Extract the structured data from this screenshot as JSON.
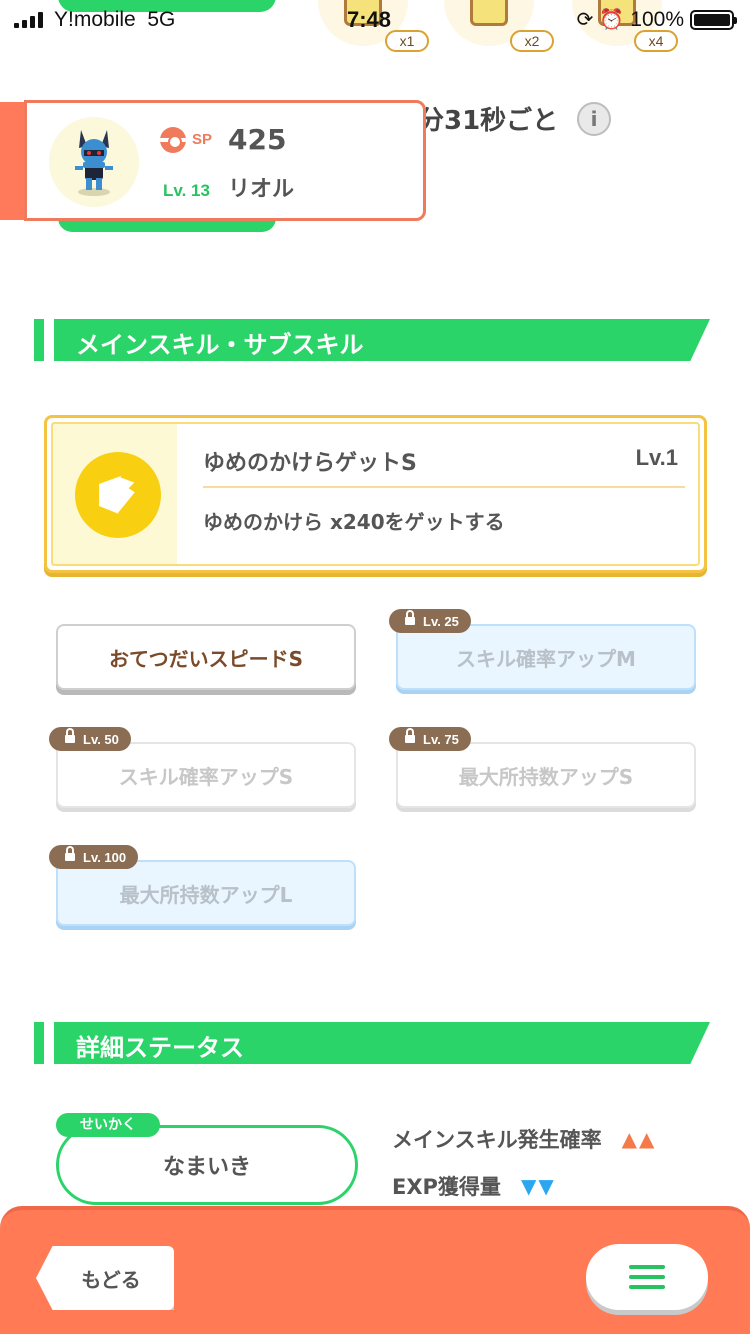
{
  "status_bar": {
    "carrier": "Y!mobile",
    "network": "5G",
    "time": "7:48",
    "battery": "100%"
  },
  "top_partial": {
    "multipliers": [
      "x1",
      "x2",
      "x4"
    ],
    "interval_text": "分31秒ごと",
    "info_label": "i"
  },
  "pokemon": {
    "sp_label": "SP",
    "sp_value": "425",
    "level": "Lv. 13",
    "name": "リオル"
  },
  "section_skills": {
    "title": "メインスキル・サブスキル"
  },
  "main_skill": {
    "name": "ゆめのかけらゲットS",
    "level": "Lv.1",
    "description": "ゆめのかけら x240をゲットする"
  },
  "sub_skills": [
    {
      "name": "おてつだいスピードS",
      "unlock": ""
    },
    {
      "name": "スキル確率アップM",
      "unlock": "Lv. 25"
    },
    {
      "name": "スキル確率アップS",
      "unlock": "Lv. 50"
    },
    {
      "name": "最大所持数アップS",
      "unlock": "Lv. 75"
    },
    {
      "name": "最大所持数アップL",
      "unlock": "Lv. 100"
    }
  ],
  "section_details": {
    "title": "詳細ステータス"
  },
  "nature": {
    "tag": "せいかく",
    "value": "なまいき",
    "up_stat": "メインスキル発生確率",
    "up_marks": "▲▲",
    "down_stat": "EXP獲得量",
    "down_marks": "▼▼"
  },
  "nav": {
    "back_label": "もどる"
  },
  "colors": {
    "accent_green": "#2ad468",
    "accent_orange": "#ff7a55",
    "skill_yellow": "#f9cf12",
    "up_color": "#f57a4a",
    "down_color": "#2aa7f0"
  }
}
